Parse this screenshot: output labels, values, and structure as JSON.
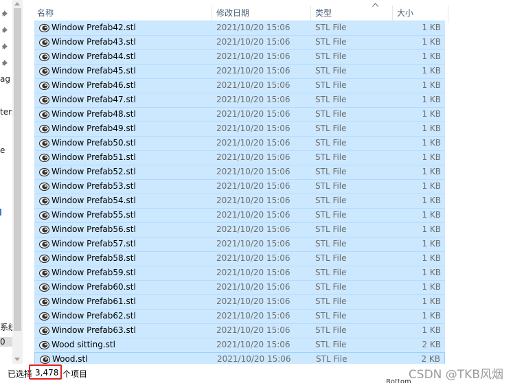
{
  "nav_fragments": [
    "ag",
    "ters",
    "e",
    "系统",
    "0"
  ],
  "columns": {
    "name": "名称",
    "modified": "修改日期",
    "type": "类型",
    "size": "大小"
  },
  "files": [
    {
      "name": "Window Prefab42.stl",
      "modified": "2021/10/20 15:06",
      "type": "STL File",
      "size": "1 KB"
    },
    {
      "name": "Window Prefab43.stl",
      "modified": "2021/10/20 15:06",
      "type": "STL File",
      "size": "1 KB"
    },
    {
      "name": "Window Prefab44.stl",
      "modified": "2021/10/20 15:06",
      "type": "STL File",
      "size": "1 KB"
    },
    {
      "name": "Window Prefab45.stl",
      "modified": "2021/10/20 15:06",
      "type": "STL File",
      "size": "1 KB"
    },
    {
      "name": "Window Prefab46.stl",
      "modified": "2021/10/20 15:06",
      "type": "STL File",
      "size": "1 KB"
    },
    {
      "name": "Window Prefab47.stl",
      "modified": "2021/10/20 15:06",
      "type": "STL File",
      "size": "1 KB"
    },
    {
      "name": "Window Prefab48.stl",
      "modified": "2021/10/20 15:06",
      "type": "STL File",
      "size": "1 KB"
    },
    {
      "name": "Window Prefab49.stl",
      "modified": "2021/10/20 15:06",
      "type": "STL File",
      "size": "1 KB"
    },
    {
      "name": "Window Prefab50.stl",
      "modified": "2021/10/20 15:06",
      "type": "STL File",
      "size": "1 KB"
    },
    {
      "name": "Window Prefab51.stl",
      "modified": "2021/10/20 15:06",
      "type": "STL File",
      "size": "1 KB"
    },
    {
      "name": "Window Prefab52.stl",
      "modified": "2021/10/20 15:06",
      "type": "STL File",
      "size": "1 KB"
    },
    {
      "name": "Window Prefab53.stl",
      "modified": "2021/10/20 15:06",
      "type": "STL File",
      "size": "1 KB"
    },
    {
      "name": "Window Prefab54.stl",
      "modified": "2021/10/20 15:06",
      "type": "STL File",
      "size": "1 KB"
    },
    {
      "name": "Window Prefab55.stl",
      "modified": "2021/10/20 15:06",
      "type": "STL File",
      "size": "1 KB"
    },
    {
      "name": "Window Prefab56.stl",
      "modified": "2021/10/20 15:06",
      "type": "STL File",
      "size": "1 KB"
    },
    {
      "name": "Window Prefab57.stl",
      "modified": "2021/10/20 15:06",
      "type": "STL File",
      "size": "1 KB"
    },
    {
      "name": "Window Prefab58.stl",
      "modified": "2021/10/20 15:06",
      "type": "STL File",
      "size": "1 KB"
    },
    {
      "name": "Window Prefab59.stl",
      "modified": "2021/10/20 15:06",
      "type": "STL File",
      "size": "1 KB"
    },
    {
      "name": "Window Prefab60.stl",
      "modified": "2021/10/20 15:06",
      "type": "STL File",
      "size": "1 KB"
    },
    {
      "name": "Window Prefab61.stl",
      "modified": "2021/10/20 15:06",
      "type": "STL File",
      "size": "1 KB"
    },
    {
      "name": "Window Prefab62.stl",
      "modified": "2021/10/20 15:06",
      "type": "STL File",
      "size": "1 KB"
    },
    {
      "name": "Window Prefab63.stl",
      "modified": "2021/10/20 15:06",
      "type": "STL File",
      "size": "1 KB"
    },
    {
      "name": "Wood sitting.stl",
      "modified": "2021/10/20 15:06",
      "type": "STL File",
      "size": "2 KB"
    },
    {
      "name": "Wood.stl",
      "modified": "2021/10/20 15:06",
      "type": "STL File",
      "size": "2 KB"
    }
  ],
  "status": {
    "prefix": "已选择",
    "selected_count": "3,478",
    "suffix": "个项目"
  },
  "watermark": "CSDN @TKB风烟",
  "below_fragment": "Bottom"
}
